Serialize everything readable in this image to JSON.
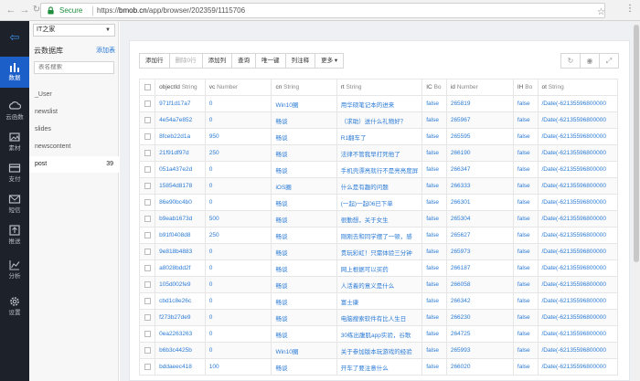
{
  "browser": {
    "secure_label": "Secure",
    "url_scheme": "https://",
    "url_host": "bmob.cn",
    "url_path": "/app/browser/202359/1115706"
  },
  "leftnav": {
    "items": [
      {
        "label": "数据",
        "icon": "bar-chart-icon",
        "active": true
      },
      {
        "label": "云函数",
        "icon": "cloud-code-icon"
      },
      {
        "label": "素材",
        "icon": "media-icon"
      },
      {
        "label": "支付",
        "icon": "card-icon"
      },
      {
        "label": "短信",
        "icon": "mail-icon"
      },
      {
        "label": "推送",
        "icon": "push-icon"
      },
      {
        "label": "分析",
        "icon": "analytics-icon"
      },
      {
        "label": "设置",
        "icon": "gear-icon"
      }
    ]
  },
  "panel": {
    "app_name": "IT之家",
    "db_title": "云数据库",
    "add_table": "添加表",
    "search_placeholder": "表名搜索",
    "tables": [
      {
        "name": "_User",
        "count": ""
      },
      {
        "name": "newslist",
        "count": ""
      },
      {
        "name": "slides",
        "count": ""
      },
      {
        "name": "newscontent",
        "count": ""
      },
      {
        "name": "post",
        "count": "39",
        "active": true
      }
    ]
  },
  "toolbar": {
    "buttons": [
      "添加行",
      "删除0行",
      "添加列",
      "查询",
      "唯一键",
      "列注释",
      "更多 ▾"
    ],
    "right_icons": [
      "refresh-icon",
      "eye-icon",
      "expand-icon"
    ]
  },
  "grid": {
    "columns": [
      {
        "name": "objectId",
        "type": "String"
      },
      {
        "name": "vc",
        "type": "Number"
      },
      {
        "name": "cn",
        "type": "String"
      },
      {
        "name": "rt",
        "type": "String"
      },
      {
        "name": "IC",
        "type": "Bo"
      },
      {
        "name": "id",
        "type": "Number"
      },
      {
        "name": "IH",
        "type": "Bo"
      },
      {
        "name": "ot",
        "type": "String"
      }
    ],
    "rows": [
      [
        "971f1d17a7",
        "0",
        "Win10圈",
        "用华硕笔记本的进来",
        "false",
        "265819",
        "false",
        "/Date(-62135596800000"
      ],
      [
        "4e54a7e852",
        "0",
        "畅谈",
        "（求助）送什么礼物好？",
        "false",
        "265967",
        "false",
        "/Date(-62135596800000"
      ],
      [
        "8fceb22d1a",
        "950",
        "畅谈",
        "R1翻车了",
        "false",
        "265595",
        "false",
        "/Date(-62135596800000"
      ],
      [
        "21f91df97d",
        "250",
        "畅谈",
        "法律不管我早打死他了",
        "false",
        "266190",
        "false",
        "/Date(-62135596800000"
      ],
      [
        "051a437e2d",
        "0",
        "畅谈",
        "手机壳漂亮就行不是亮亮度屏",
        "false",
        "266347",
        "false",
        "/Date(-62135596800000"
      ],
      [
        "15854d8178",
        "0",
        "iOS圈",
        "什么是有趣的问题",
        "false",
        "266333",
        "false",
        "/Date(-62135596800000"
      ],
      [
        "86e90bc4b0",
        "0",
        "畅谈",
        "(一起)一起06已下单",
        "false",
        "266301",
        "false",
        "/Date(-62135596800000"
      ],
      [
        "b9eab1673d",
        "500",
        "畅谈",
        "很勤想，关于女生",
        "false",
        "265304",
        "false",
        "/Date(-62135596800000"
      ],
      [
        "b91f0408d8",
        "250",
        "畅谈",
        "刚刚去和同学摆了一顿，感",
        "false",
        "265627",
        "false",
        "/Date(-62135596800000"
      ],
      [
        "9e818b4883",
        "0",
        "畅谈",
        "贵玩彩虹！只需体验三分钟",
        "false",
        "265973",
        "false",
        "/Date(-62135596800000"
      ],
      [
        "a8028bdd2f",
        "0",
        "畅谈",
        "网上根据可以买药",
        "false",
        "266187",
        "false",
        "/Date(-62135596800000"
      ],
      [
        "105d002fe9",
        "0",
        "畅谈",
        "人活着的意义是什么",
        "false",
        "266058",
        "false",
        "/Date(-62135596800000"
      ],
      [
        "cbd1c8e26c",
        "0",
        "畅谈",
        "富士康",
        "false",
        "266342",
        "false",
        "/Date(-62135596800000"
      ],
      [
        "f273b27de9",
        "0",
        "畅谈",
        "电脑搜索软件有比人生日",
        "false",
        "266230",
        "false",
        "/Date(-62135596800000"
      ],
      [
        "0ea2263263",
        "0",
        "畅谈",
        "30练出腹肌app实验，谷歌",
        "false",
        "264725",
        "false",
        "/Date(-62135596800000"
      ],
      [
        "b6b3c4425b",
        "0",
        "Win10圈",
        "关于参加版本玩游戏的经验",
        "false",
        "265993",
        "false",
        "/Date(-62135596800000"
      ],
      [
        "bddaeec418",
        "100",
        "畅谈",
        "开车了要注意什么",
        "false",
        "266020",
        "false",
        "/Date(-62135596800000"
      ]
    ]
  }
}
